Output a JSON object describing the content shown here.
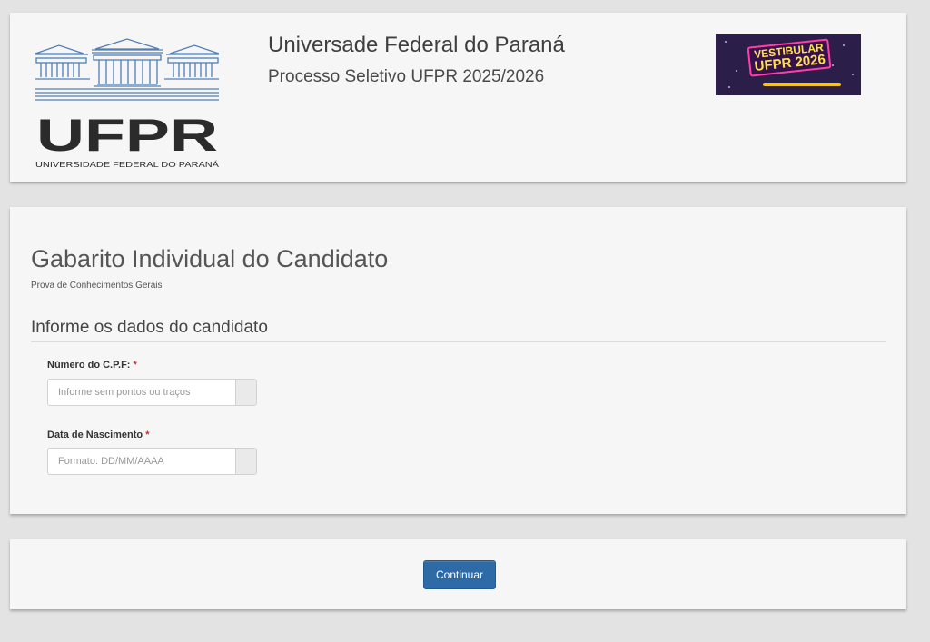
{
  "header": {
    "logo_wordmark": "UFPR",
    "logo_caption": "UNIVERSIDADE FEDERAL DO PARANÁ",
    "university_name": "Universade Federal do Paraná",
    "process_name": "Processo Seletivo UFPR 2025/2026",
    "banner_line1": "VESTIBULAR",
    "banner_line2": "UFPR 2026"
  },
  "form": {
    "title": "Gabarito Individual do Candidato",
    "subtitle": "Prova de Conhecimentos Gerais",
    "section_title": "Informe os dados do candidato",
    "cpf": {
      "label": "Número do C.P.F:",
      "required_mark": "*",
      "placeholder": "Informe sem pontos ou traços",
      "value": ""
    },
    "birth": {
      "label": "Data de Nascimento",
      "required_mark": "*",
      "placeholder": "Formato: DD/MM/AAAA",
      "value": ""
    }
  },
  "actions": {
    "continue_label": "Continuar"
  },
  "colors": {
    "page_bg": "#e3e3e3",
    "card_bg": "#f6f6f6",
    "primary_button": "#2d6aa6",
    "required": "#c9302c",
    "logo_blue": "#4f7fb5"
  }
}
